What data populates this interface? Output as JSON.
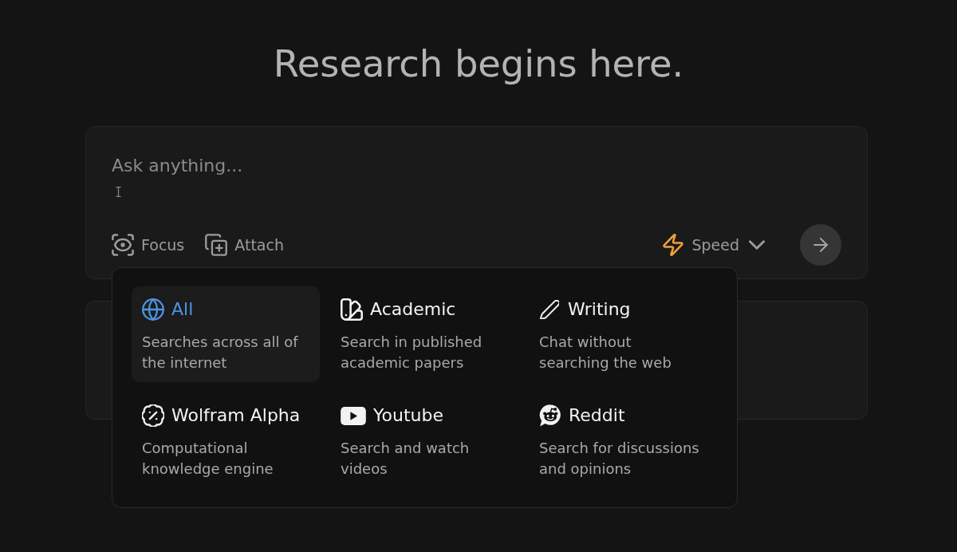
{
  "heading": "Research begins here.",
  "search": {
    "placeholder": "Ask anything...",
    "focus_button": {
      "label": "Focus"
    },
    "attach_button": {
      "label": "Attach"
    },
    "mode_button": {
      "label": "Speed"
    }
  },
  "focus_menu": {
    "options": [
      {
        "title": "All",
        "description": "Searches across all of the internet",
        "selected": true
      },
      {
        "title": "Academic",
        "description": "Search in published academic papers",
        "selected": false
      },
      {
        "title": "Writing",
        "description": "Chat without searching the web",
        "selected": false
      },
      {
        "title": "Wolfram Alpha",
        "description": "Computational knowledge engine",
        "selected": false
      },
      {
        "title": "Youtube",
        "description": "Search and watch videos",
        "selected": false
      },
      {
        "title": "Reddit",
        "description": "Search for discussions and opinions",
        "selected": false
      }
    ]
  }
}
